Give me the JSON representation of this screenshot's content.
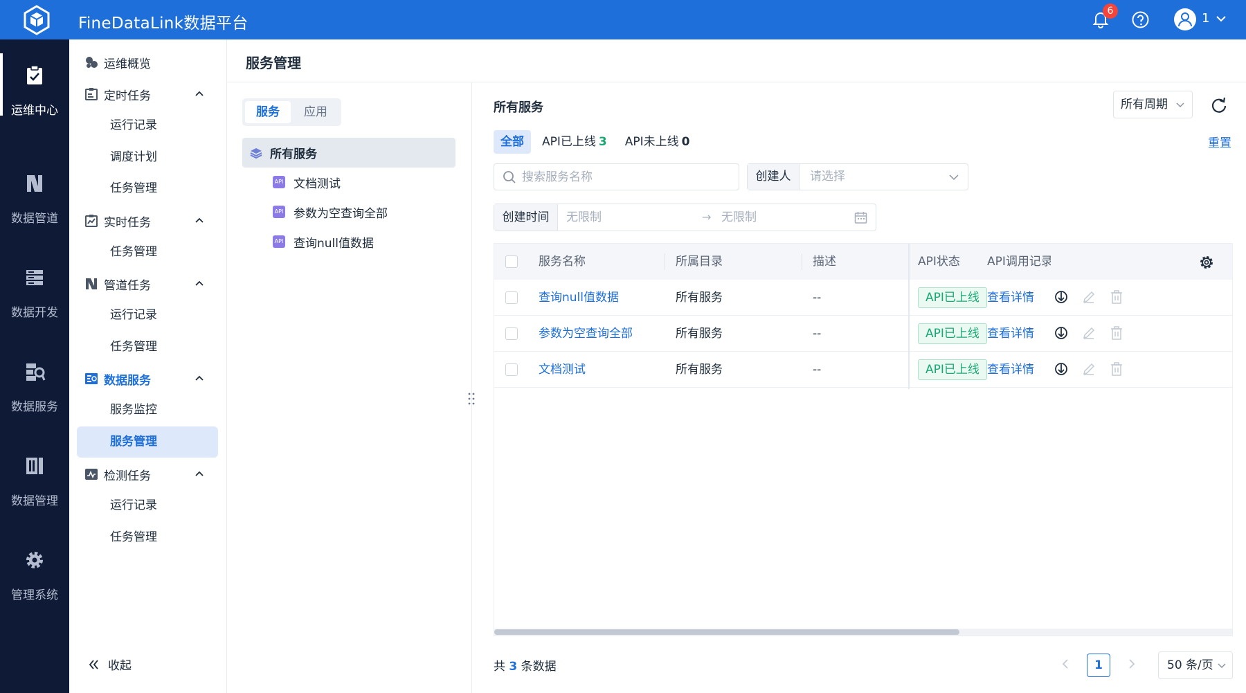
{
  "app": {
    "title": "FineDataLink数据平台",
    "notification_count": "6",
    "user_name": "1",
    "accent": "#1e6fd9"
  },
  "rail": {
    "items": [
      {
        "label": "运维中心",
        "icon": "clipboard-check-icon"
      },
      {
        "label": "数据管道",
        "icon": "pipeline-icon"
      },
      {
        "label": "数据开发",
        "icon": "server-stack-icon"
      },
      {
        "label": "数据服务",
        "icon": "data-service-icon"
      },
      {
        "label": "数据管理",
        "icon": "book-stack-icon"
      },
      {
        "label": "管理系统",
        "icon": "gear-icon"
      }
    ]
  },
  "sidemenu": {
    "overview": "运维概览",
    "groups": [
      {
        "label": "定时任务",
        "children": [
          "运行记录",
          "调度计划",
          "任务管理"
        ]
      },
      {
        "label": "实时任务",
        "children": [
          "任务管理"
        ]
      },
      {
        "label": "管道任务",
        "children": [
          "运行记录",
          "任务管理"
        ]
      },
      {
        "label": "数据服务",
        "children": [
          "服务监控",
          "服务管理"
        ]
      },
      {
        "label": "检测任务",
        "children": [
          "运行记录",
          "任务管理"
        ]
      }
    ],
    "collapse_label": "收起"
  },
  "page": {
    "title": "服务管理"
  },
  "tree": {
    "tabs": [
      "服务",
      "应用"
    ],
    "root_label": "所有服务",
    "api_badge": "API",
    "items": [
      "文档测试",
      "参数为空查询全部",
      "查询null值数据"
    ]
  },
  "main": {
    "title": "所有服务",
    "period_select": "所有周期",
    "filter_tabs": {
      "all": "全部",
      "online_label": "API已上线",
      "online_count": "3",
      "offline_label": "API未上线",
      "offline_count": "0"
    },
    "reset": "重置",
    "search_placeholder": "搜索服务名称",
    "creator_label": "创建人",
    "creator_placeholder": "请选择",
    "time_label": "创建时间",
    "time_from": "无限制",
    "time_to": "无限制",
    "time_arrow": "→"
  },
  "table": {
    "columns": [
      "服务名称",
      "所属目录",
      "描述",
      "API状态",
      "API调用记录"
    ],
    "rows": [
      {
        "name": "查询null值数据",
        "dir": "所有服务",
        "desc": "--",
        "status": "API已上线",
        "record": "查看详情"
      },
      {
        "name": "参数为空查询全部",
        "dir": "所有服务",
        "desc": "--",
        "status": "API已上线",
        "record": "查看详情"
      },
      {
        "name": "文档测试",
        "dir": "所有服务",
        "desc": "--",
        "status": "API已上线",
        "record": "查看详情"
      }
    ]
  },
  "pager": {
    "total_prefix": "共",
    "total": "3",
    "total_suffix": "条数据",
    "current_page": "1",
    "page_size": "50 条/页"
  }
}
